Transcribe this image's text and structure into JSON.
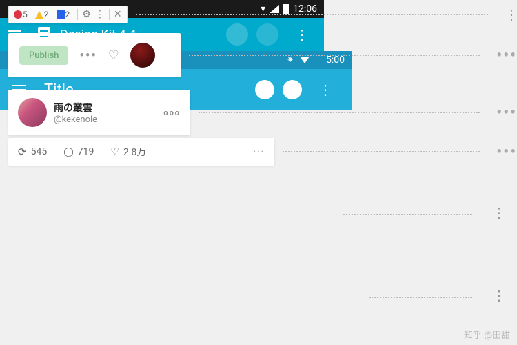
{
  "toolbar": {
    "errors": "5",
    "warnings": "2",
    "messages": "2"
  },
  "publish": {
    "label": "Publish"
  },
  "user": {
    "name": "雨の叢雲",
    "handle": "@kekenole"
  },
  "stats": {
    "retweets": "545",
    "comments": "719",
    "likes": "2.8万"
  },
  "android1": {
    "title": "Design Kit 4.4",
    "time": "12:06"
  },
  "android2": {
    "title": "Title",
    "time": "5:00"
  },
  "watermark": "知乎 @田甜"
}
